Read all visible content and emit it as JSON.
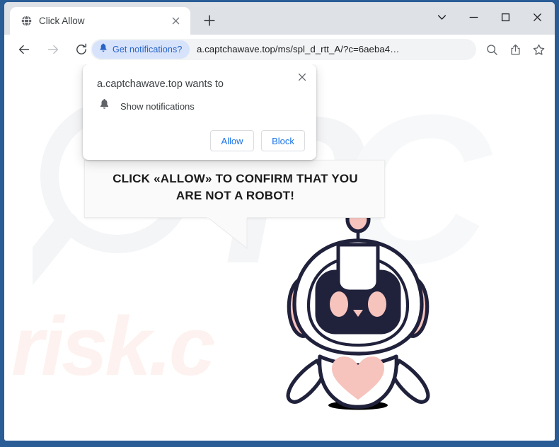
{
  "browser": {
    "tab": {
      "title": "Click Allow",
      "favicon_icon": "globe-icon",
      "close_icon": "close-icon"
    },
    "new_tab_icon": "plus-icon",
    "window_controls": [
      {
        "name": "tab-search",
        "icon": "chevron-down-icon"
      },
      {
        "name": "minimize",
        "icon": "minimize-icon"
      },
      {
        "name": "maximize",
        "icon": "maximize-icon"
      },
      {
        "name": "close",
        "icon": "close-icon"
      }
    ],
    "nav": {
      "back_icon": "arrow-left-icon",
      "forward_icon": "arrow-right-icon",
      "reload_icon": "reload-icon"
    },
    "omnibox": {
      "notification_chip": {
        "label": "Get notifications?",
        "icon": "bell-icon",
        "text_color": "#2764c8",
        "bg_color": "#d7e3fb"
      },
      "url": "a.captchawave.top/ms/spl_d_rtt_A/?c=6aeba4…"
    },
    "toolbar_icons": [
      {
        "name": "zoom-search-icon",
        "glyph": "search"
      },
      {
        "name": "share-icon",
        "glyph": "share"
      },
      {
        "name": "bookmark-star-icon",
        "glyph": "star"
      },
      {
        "name": "side-panel-icon",
        "glyph": "panel"
      },
      {
        "name": "profile-avatar",
        "glyph": "person"
      },
      {
        "name": "chrome-menu-icon",
        "glyph": "kebab"
      }
    ]
  },
  "permission_popup": {
    "title": "a.captchawave.top wants to",
    "permission_label": "Show notifications",
    "permission_icon": "bell-icon",
    "close_icon": "close-icon",
    "allow_label": "Allow",
    "block_label": "Block",
    "link_color": "#1a73e8"
  },
  "page": {
    "bubble_line1": "CLICK «ALLOW» TO CONFIRM THAT YOU",
    "bubble_line2": "ARE NOT A ROBOT!",
    "watermark_text": "risk.c",
    "watermark_badge": "pcrisk-magnifier-watermark",
    "robot": {
      "name": "robot-mascot",
      "outline_color": "#20213b",
      "accent_color": "#f6c3bd",
      "visor_color": "#20213b",
      "body_color": "#ffffff"
    }
  }
}
